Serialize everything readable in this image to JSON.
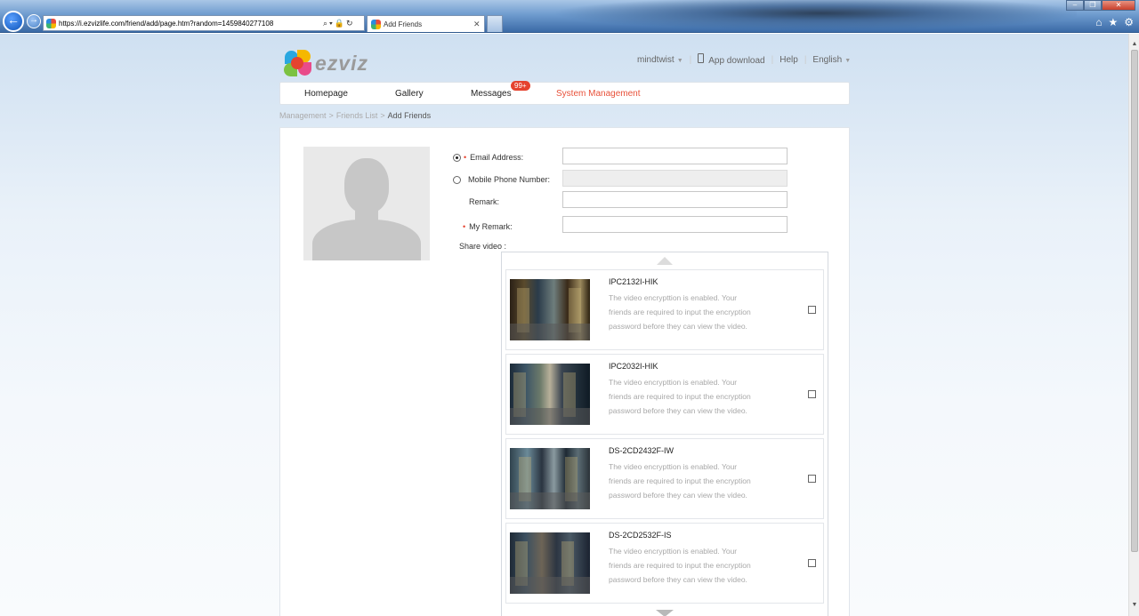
{
  "browser": {
    "url": "https://i.ezvizlife.com/friend/add/page.htm?random=1459840277108",
    "tab_title": "Add Friends",
    "tab_close": "✕"
  },
  "header": {
    "logo_text": "ezviz",
    "user": "mindtwist",
    "app_download": "App download",
    "help": "Help",
    "language": "English"
  },
  "nav": {
    "items": [
      "Homepage",
      "Gallery",
      "Messages",
      "System Management"
    ],
    "active": "System Management",
    "messages_badge": "99+"
  },
  "breadcrumb": [
    "Management",
    "Friends List",
    "Add Friends"
  ],
  "form": {
    "email_label": "Email Address:",
    "email_value": "",
    "phone_label": "Mobile Phone Number:",
    "phone_value": "",
    "remark_label": "Remark:",
    "remark_value": "",
    "my_remark_label": "My Remark:",
    "my_remark_value": "",
    "required_mark": "•",
    "selected_contact": "email"
  },
  "share": {
    "label": "Share video :",
    "devices": [
      {
        "name": "IPC2132I-HIK",
        "desc": "The video encrypttion is enabled. Your friends are required to input the encryption password before they can view the video.",
        "checked": false
      },
      {
        "name": "IPC2032I-HIK",
        "desc": "The video encrypttion is enabled. Your friends are required to input the encryption password before they can view the video.",
        "checked": false
      },
      {
        "name": "DS-2CD2432F-IW",
        "desc": "The video encrypttion is enabled. Your friends are required to input the encryption password before they can view the video.",
        "checked": false
      },
      {
        "name": "DS-2CD2532F-IS",
        "desc": "The video encrypttion is enabled. Your friends are required to input the encryption password before they can view the video.",
        "checked": false
      }
    ]
  },
  "colors": {
    "accent": "#e8513a",
    "badge": "#e5432f"
  },
  "icons": {
    "back": "back-arrow-icon",
    "forward": "forward-arrow-icon",
    "home": "home-icon",
    "favorites": "star-icon",
    "tools": "gear-icon"
  }
}
